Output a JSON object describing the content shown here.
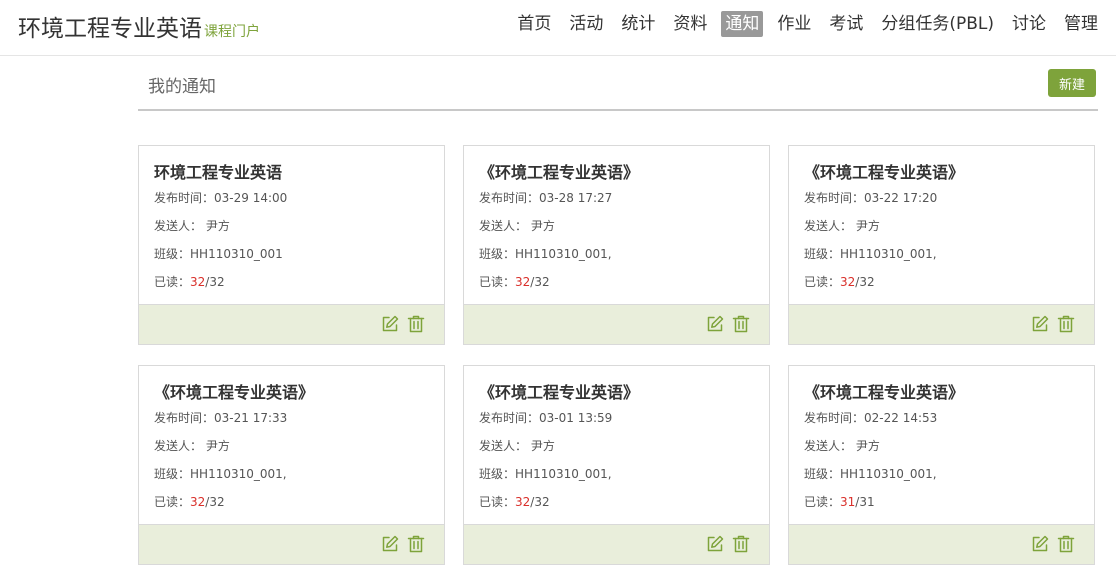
{
  "header": {
    "title": "环境工程专业英语",
    "subtitle": "课程门户",
    "nav": [
      "首页",
      "活动",
      "统计",
      "资料",
      "通知",
      "作业",
      "考试",
      "分组任务(PBL)",
      "讨论",
      "管理"
    ],
    "active_nav": "通知"
  },
  "section": {
    "title": "我的通知",
    "new_label": "新建"
  },
  "labels": {
    "time_prefix": "发布时间：",
    "sender_prefix": "发送人：",
    "class_prefix": "班级：",
    "read_prefix": "已读："
  },
  "notices": [
    {
      "title": "环境工程专业英语",
      "time": "03-29 14:00",
      "sender": "尹方",
      "class": "HH110310_001",
      "read": "32",
      "total": "/32"
    },
    {
      "title": "《环境工程专业英语》",
      "time": "03-28 17:27",
      "sender": "尹方",
      "class": "HH110310_001,",
      "read": "32",
      "total": "/32"
    },
    {
      "title": "《环境工程专业英语》",
      "time": "03-22 17:20",
      "sender": "尹方",
      "class": "HH110310_001,",
      "read": "32",
      "total": "/32"
    },
    {
      "title": "《环境工程专业英语》",
      "time": "03-21 17:33",
      "sender": "尹方",
      "class": "HH110310_001,",
      "read": "32",
      "total": "/32"
    },
    {
      "title": "《环境工程专业英语》",
      "time": "03-01 13:59",
      "sender": "尹方",
      "class": "HH110310_001,",
      "read": "32",
      "total": "/32"
    },
    {
      "title": "《环境工程专业英语》",
      "time": "02-22 14:53",
      "sender": "尹方",
      "class": "HH110310_001,",
      "read": "31",
      "total": "/31"
    }
  ],
  "icons": {
    "edit": "edit-icon",
    "delete": "trash-icon"
  },
  "colors": {
    "accent": "#7ea33b",
    "read": "#d9302b",
    "footer": "#e9eedb"
  }
}
